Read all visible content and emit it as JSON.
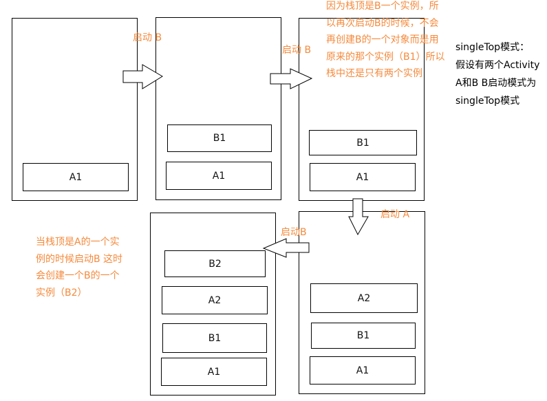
{
  "diagram": {
    "title_note": [
      "singleTop模式：",
      "假设有两个Activity",
      "A和B B启动模式为",
      "singleTop模式"
    ],
    "stacks": [
      {
        "id": "stack-1",
        "items": [
          "A1"
        ]
      },
      {
        "id": "stack-2",
        "items": [
          "B1",
          "A1"
        ]
      },
      {
        "id": "stack-3",
        "items": [
          "B1",
          "A1"
        ]
      },
      {
        "id": "stack-4",
        "items": [
          "A2",
          "B1",
          "A1"
        ]
      },
      {
        "id": "stack-5",
        "items": [
          "B2",
          "A2",
          "B1",
          "A1"
        ]
      }
    ],
    "transitions": [
      {
        "from": "stack-1",
        "to": "stack-2",
        "label": "启动 B",
        "direction": "right"
      },
      {
        "from": "stack-2",
        "to": "stack-3",
        "label": "启动 B",
        "direction": "right"
      },
      {
        "from": "stack-3",
        "to": "stack-4",
        "label": "启动 A",
        "direction": "down"
      },
      {
        "from": "stack-4",
        "to": "stack-5",
        "label": "启动B",
        "direction": "left"
      }
    ],
    "notes": {
      "reuse_note": [
        "因为栈顶是B一个实例，所",
        "以再次启动B的时候，不会",
        "再创建B的一个对象而是用",
        "原来的那个实例（B1）所以",
        "栈中还是只有两个实例"
      ],
      "create_note": [
        "当栈顶是A的一个实",
        "例的时候启动B 这时",
        "会创建一个B的一个",
        "实例（B2）"
      ]
    },
    "colors": {
      "annotation": "#f58a3c",
      "stroke": "#000000",
      "text": "#111111"
    }
  }
}
